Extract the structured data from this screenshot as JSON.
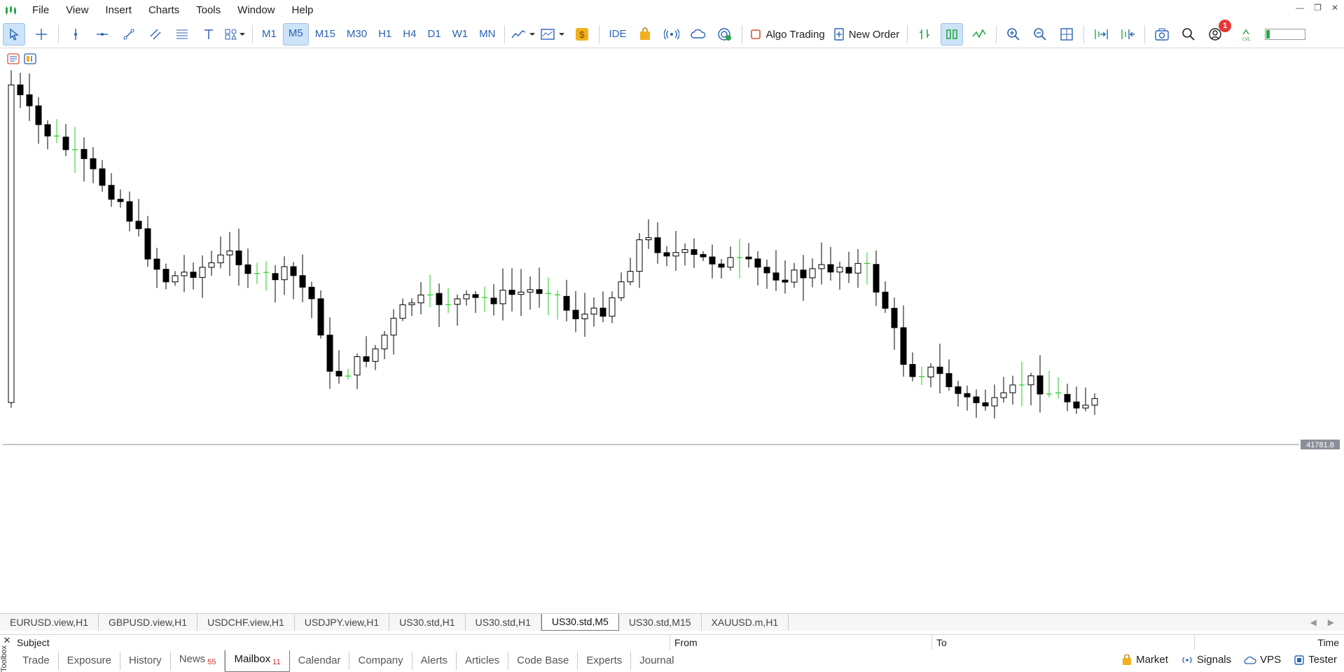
{
  "menu": {
    "items": [
      "File",
      "View",
      "Insert",
      "Charts",
      "Tools",
      "Window",
      "Help"
    ]
  },
  "toolbar": {
    "timeframes": [
      "M1",
      "M5",
      "M15",
      "M30",
      "H1",
      "H4",
      "D1",
      "W1",
      "MN"
    ],
    "active_timeframe": "M5",
    "ide_label": "IDE",
    "algo_trading_label": "Algo Trading",
    "new_order_label": "New Order",
    "notifications_count": "1",
    "accent_color": "#2a62b5",
    "active_bg": "#cde3f8"
  },
  "chart": {
    "symbol_timeframe": "US30.std,M5",
    "current_price_label": "41781.8",
    "price_line_color": "#8a8f99",
    "bull_body_color": "#ffffff",
    "bear_body_color": "#000000",
    "doji_color": "#22cc22"
  },
  "chart_tabs": {
    "items": [
      "EURUSD.view,H1",
      "GBPUSD.view,H1",
      "USDCHF.view,H1",
      "USDJPY.view,H1",
      "US30.std,H1",
      "US30.std,H1",
      "US30.std,M5",
      "US30.std,M15",
      "XAUUSD.m,H1"
    ],
    "active_index": 6
  },
  "toolbox": {
    "columns": {
      "subject": "Subject",
      "from": "From",
      "to": "To",
      "time": "Time"
    },
    "side_label": "Toolbox",
    "tabs": [
      {
        "label": "Trade",
        "count": ""
      },
      {
        "label": "Exposure",
        "count": ""
      },
      {
        "label": "History",
        "count": ""
      },
      {
        "label": "News",
        "count": "55"
      },
      {
        "label": "Mailbox",
        "count": "11"
      },
      {
        "label": "Calendar",
        "count": ""
      },
      {
        "label": "Company",
        "count": ""
      },
      {
        "label": "Alerts",
        "count": ""
      },
      {
        "label": "Articles",
        "count": ""
      },
      {
        "label": "Code Base",
        "count": ""
      },
      {
        "label": "Experts",
        "count": ""
      },
      {
        "label": "Journal",
        "count": ""
      }
    ],
    "active_tab": "Mailbox"
  },
  "status": {
    "market_label": "Market",
    "signals_label": "Signals",
    "vps_label": "VPS",
    "tester_label": "Tester"
  }
}
